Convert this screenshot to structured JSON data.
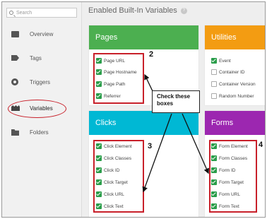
{
  "sidebar": {
    "search_placeholder": "Search",
    "items": [
      {
        "label": "Overview"
      },
      {
        "label": "Tags"
      },
      {
        "label": "Triggers"
      },
      {
        "label": "Variables"
      },
      {
        "label": "Folders"
      }
    ]
  },
  "main": {
    "title": "Enabled Built-In Variables",
    "help_glyph": "?"
  },
  "cards": {
    "pages": {
      "title": "Pages",
      "color": "#4caf50",
      "items": [
        {
          "label": "Page URL",
          "checked": true
        },
        {
          "label": "Page Hostname",
          "checked": true
        },
        {
          "label": "Page Path",
          "checked": true
        },
        {
          "label": "Referrer",
          "checked": true
        }
      ]
    },
    "utilities": {
      "title": "Utilities",
      "color": "#f39c12",
      "items": [
        {
          "label": "Event",
          "checked": true
        },
        {
          "label": "Container ID",
          "checked": false
        },
        {
          "label": "Container Version",
          "checked": false
        },
        {
          "label": "Random Number",
          "checked": false
        }
      ]
    },
    "clicks": {
      "title": "Clicks",
      "color": "#00b8d4",
      "items": [
        {
          "label": "Click Element",
          "checked": true
        },
        {
          "label": "Click Classes",
          "checked": true
        },
        {
          "label": "Click ID",
          "checked": true
        },
        {
          "label": "Click Target",
          "checked": true
        },
        {
          "label": "Click URL",
          "checked": true
        },
        {
          "label": "Click Text",
          "checked": true
        }
      ]
    },
    "forms": {
      "title": "Forms",
      "color": "#9c27b0",
      "items": [
        {
          "label": "Form Element",
          "checked": true
        },
        {
          "label": "Form Classes",
          "checked": true
        },
        {
          "label": "Form ID",
          "checked": true
        },
        {
          "label": "Form Target",
          "checked": true
        },
        {
          "label": "Form URL",
          "checked": true
        },
        {
          "label": "Form Text",
          "checked": true
        }
      ]
    }
  },
  "annotations": {
    "callout_line1": "Check these",
    "callout_line2": "boxes",
    "num2": "2",
    "num3": "3",
    "num4": "4",
    "highlight_color": "#c8202a"
  }
}
